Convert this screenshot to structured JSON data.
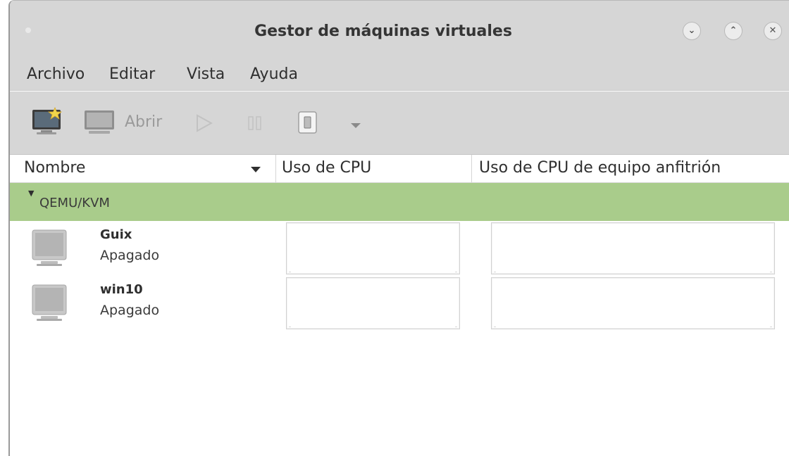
{
  "window": {
    "title": "Gestor de máquinas virtuales",
    "controls": [
      "minimize",
      "maximize",
      "close"
    ]
  },
  "menubar": {
    "items": [
      "Archivo",
      "Editar",
      "Vista",
      "Ayuda"
    ]
  },
  "toolbar": {
    "new_vm_icon": "new-vm-icon",
    "open_label": "Abrir",
    "run_icon": "play-icon",
    "pause_icon": "pause-icon",
    "shutdown_icon": "power-icon",
    "dropdown_icon": "chevron-down-icon"
  },
  "columns": {
    "name": "Nombre",
    "cpu": "Uso de CPU",
    "host_cpu": "Uso de CPU de equipo anfitrión"
  },
  "connection": {
    "label": "QEMU/KVM",
    "color": "#a9cc8b"
  },
  "vms": [
    {
      "name": "Guix",
      "status": "Apagado"
    },
    {
      "name": "win10",
      "status": "Apagado"
    }
  ]
}
